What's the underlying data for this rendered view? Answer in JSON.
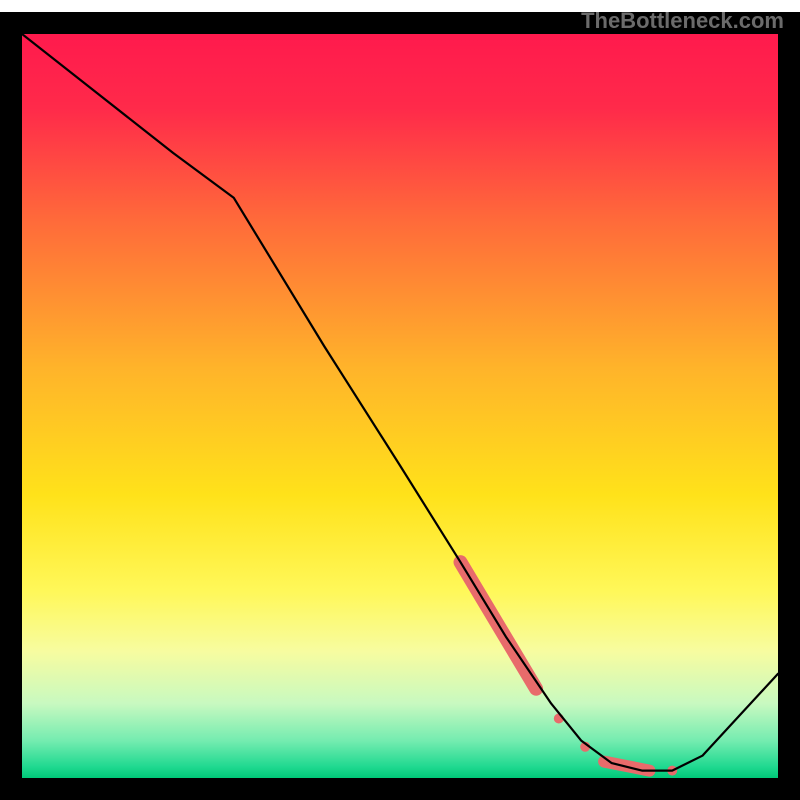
{
  "watermark": "TheBottleneck.com",
  "gradient": {
    "stops": [
      {
        "offset": 0.0,
        "color": "#ff1a4d"
      },
      {
        "offset": 0.1,
        "color": "#ff2a4a"
      },
      {
        "offset": 0.25,
        "color": "#ff6a3a"
      },
      {
        "offset": 0.45,
        "color": "#ffb42a"
      },
      {
        "offset": 0.62,
        "color": "#ffe21a"
      },
      {
        "offset": 0.75,
        "color": "#fff85a"
      },
      {
        "offset": 0.83,
        "color": "#f7fca0"
      },
      {
        "offset": 0.9,
        "color": "#c8f9c0"
      },
      {
        "offset": 0.95,
        "color": "#74ecb0"
      },
      {
        "offset": 0.985,
        "color": "#1fd990"
      },
      {
        "offset": 1.0,
        "color": "#00c878"
      }
    ]
  },
  "plot": {
    "inner_x": 22,
    "inner_y": 34,
    "inner_w": 756,
    "inner_h": 744,
    "border_color": "#000000",
    "border_width": 22
  },
  "chart_data": {
    "type": "line",
    "title": "",
    "xlabel": "",
    "ylabel": "",
    "xlim": [
      0,
      100
    ],
    "ylim": [
      0,
      100
    ],
    "series": [
      {
        "name": "curve",
        "color": "#000000",
        "width": 2.2,
        "x": [
          0,
          10,
          20,
          28,
          40,
          50,
          58,
          64,
          70,
          74,
          78,
          82,
          86,
          90,
          100
        ],
        "y": [
          100,
          92,
          84,
          78,
          58,
          42,
          29,
          19,
          10,
          5,
          2,
          1,
          1,
          3,
          14
        ]
      }
    ],
    "markers": {
      "name": "highlight-dots",
      "color": "#e86b6b",
      "groups": [
        {
          "type": "segment",
          "x0": 58,
          "y0": 29,
          "x1": 68,
          "y1": 12,
          "radius": 7
        },
        {
          "type": "point",
          "x": 71,
          "y": 8,
          "radius": 5
        },
        {
          "type": "point",
          "x": 74.5,
          "y": 4.2,
          "radius": 5
        },
        {
          "type": "segment",
          "x0": 77,
          "y0": 2.2,
          "x1": 83,
          "y1": 1.0,
          "radius": 6
        },
        {
          "type": "point",
          "x": 86,
          "y": 1.0,
          "radius": 5
        }
      ]
    }
  }
}
